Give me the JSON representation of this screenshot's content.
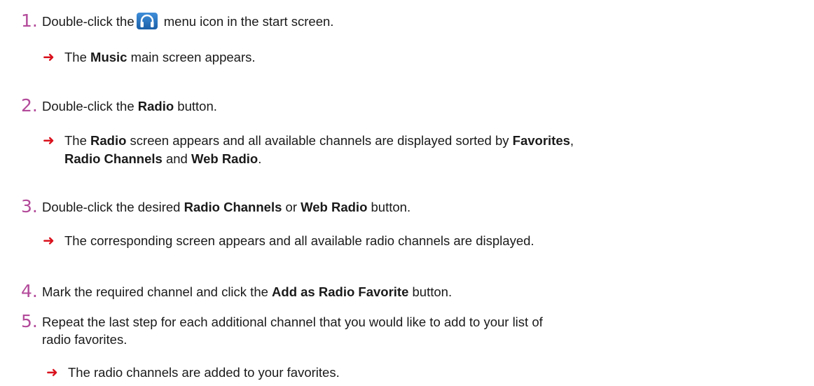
{
  "steps": [
    {
      "num": "1.",
      "pre": "Double-click the",
      "icon": "headphones-icon",
      "post": " menu icon in the start screen.",
      "result": {
        "a": "The ",
        "b1": "Music",
        "c": " main screen appears."
      }
    },
    {
      "num": "2.",
      "pre": "Double-click the ",
      "bold": "Radio",
      "post": " button.",
      "result": {
        "a": "The ",
        "b1": "Radio",
        "c": " screen appears and all available channels are displayed sorted by ",
        "b2": "Favorites",
        "d": ",",
        "b3": "Radio Channels",
        "e": " and ",
        "b4": "Web Radio",
        "f": "."
      }
    },
    {
      "num": "3.",
      "pre": "Double-click the desired ",
      "bold1": "Radio Channels",
      "mid": " or ",
      "bold2": "Web Radio",
      "post": " button.",
      "result": {
        "a": "The corresponding screen appears and all available radio channels are displayed."
      }
    },
    {
      "num": "4.",
      "pre": "Mark the required channel and click the ",
      "bold": "Add as Radio Favorite",
      "post": " button."
    },
    {
      "num": "5.",
      "line1": "Repeat the last step for each additional channel that you would like to add to your list of",
      "line2": "radio favorites.",
      "result": {
        "a": "The radio channels are added to your favorites."
      }
    }
  ],
  "colors": {
    "step_number": "#b34a9a",
    "arrow": "#d9111c",
    "icon_bg": "#2a74c4"
  }
}
